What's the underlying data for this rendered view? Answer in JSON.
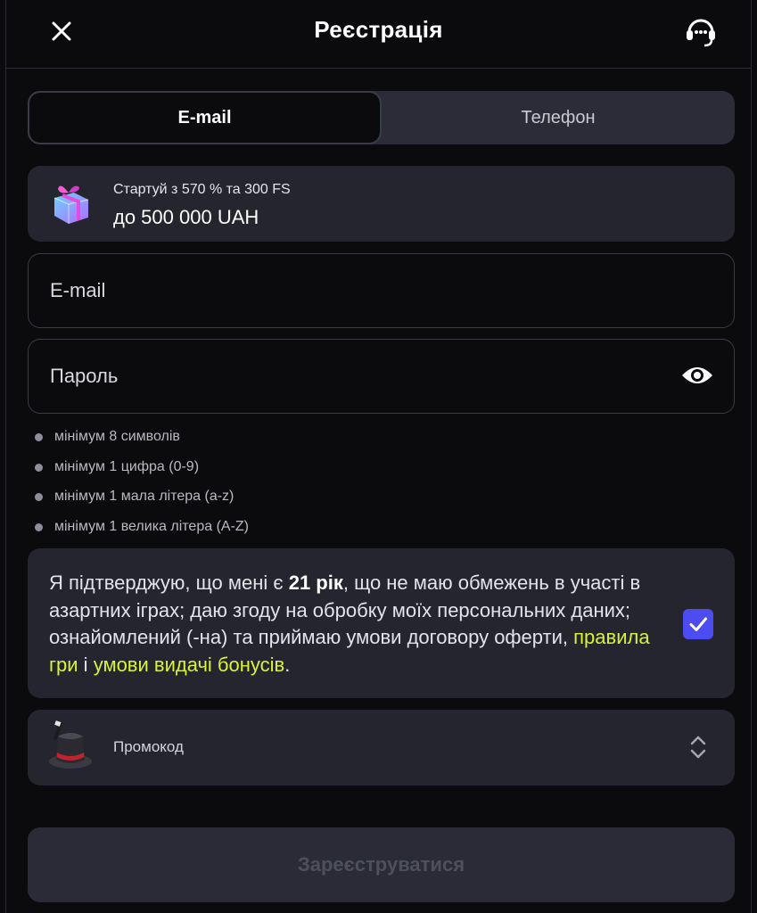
{
  "header": {
    "title": "Реєстрація"
  },
  "tabs": [
    {
      "label": "E-mail",
      "active": true
    },
    {
      "label": "Телефон",
      "active": false
    }
  ],
  "bonus": {
    "line1": "Стартуй з 570 % та 300 FS",
    "line2": "до 500 000 UAH",
    "icon": "gift-icon"
  },
  "form": {
    "email_placeholder": "E-mail",
    "email_value": "",
    "password_placeholder": "Пароль",
    "password_value": ""
  },
  "password_requirements": [
    "мінімум 8 символів",
    "мінімум 1 цифра (0-9)",
    "мінімум 1 мала літера (a-z)",
    "мінімум 1 велика літера (A-Z)"
  ],
  "consent": {
    "text_before": "Я підтверджую, що мені є ",
    "age": "21 рік",
    "text_middle": ", що не маю обмежень в участі в азартних іграх; даю згоду на обробку моїх персональних даних; ознайомлений (-на) та приймаю умови договору оферти, ",
    "link_rules": "правила гри",
    "conjunction": " і ",
    "link_bonus": "умови видачі бонусів",
    "text_end": ".",
    "checked": true
  },
  "promo": {
    "label": "Промокод",
    "icon": "magic-hat-icon"
  },
  "submit": {
    "label": "Зареєструватися"
  },
  "colors": {
    "background": "#0b0b0d",
    "card": "#24252f",
    "accent_link": "#d9f23a",
    "checkbox": "#4d4cf0",
    "submit_disabled_text": "#4e4f5c"
  }
}
